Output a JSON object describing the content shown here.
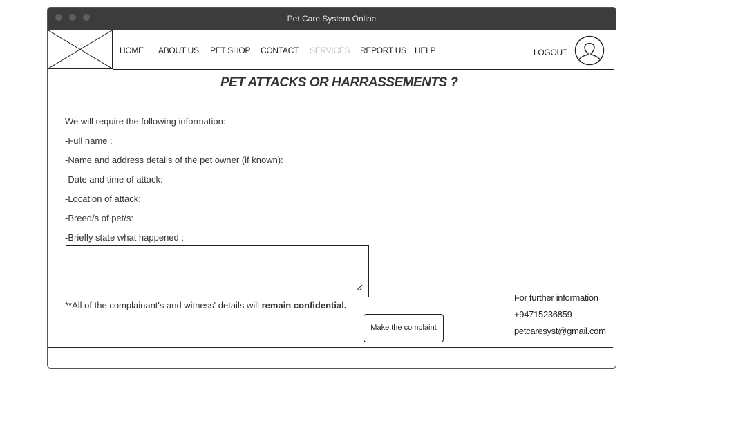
{
  "window": {
    "title": "Pet Care System Online"
  },
  "nav": {
    "items": [
      "HOME",
      "ABOUT US",
      "PET SHOP",
      "CONTACT",
      "SERVICES",
      "REPORT US",
      "HELP"
    ],
    "logout": "LOGOUT"
  },
  "main": {
    "heading": "PET ATTACKS OR HARRASSEMENTS ?",
    "intro": "We will require the following information:",
    "fields": [
      "-Full name :",
      "-Name and address details of the pet owner (if known):",
      "-Date and time of attack:",
      "-Location of attack:",
      "-Breed/s of pet/s:",
      "-Briefly state what happened :"
    ],
    "textarea_value": "",
    "confidential_prefix": "**All of the complainant's and witness' details will ",
    "confidential_bold": "remain confidential.",
    "submit_label": "Make the complaint"
  },
  "contact": {
    "heading": "For further information",
    "phone": "+94715236859",
    "email": "petcaresyst@gmail.com"
  },
  "colors": {
    "titlebar": "#3c3c3c",
    "disabled_nav": "#bdbdbd"
  },
  "icons": {
    "logo": "image-placeholder-icon",
    "avatar": "user-avatar-icon"
  }
}
